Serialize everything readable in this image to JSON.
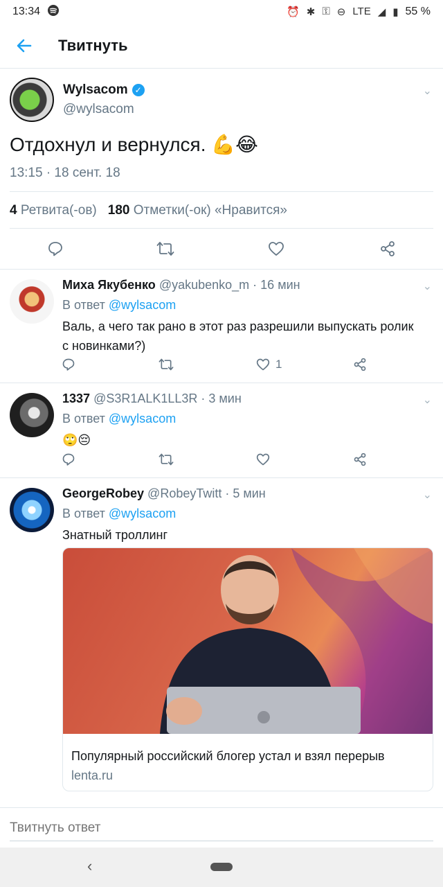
{
  "status_bar": {
    "time": "13:34",
    "network": "LTE",
    "battery": "55 %"
  },
  "header": {
    "title": "Твитнуть"
  },
  "main_tweet": {
    "name": "Wylsacom",
    "handle": "@wylsacom",
    "text": "Отдохнул и вернулся. 💪😂",
    "time": "13:15 · 18 сент. 18",
    "retweets_count": "4",
    "retweets_label": "Ретвита(-ов)",
    "likes_count": "180",
    "likes_label": "Отметки(-ок) «Нравится»"
  },
  "replies": [
    {
      "name": "Миха Якубенко",
      "meta": "@yakubenko_m · 16 мин",
      "reply_prefix": "В ответ",
      "reply_to": "@wylsacom",
      "text": "Валь, а чего так рано в этот раз разрешили выпускать ролик с новинками?)",
      "likes": "1"
    },
    {
      "name": "1337",
      "meta": "@S3R1ALK1LL3R · 3 мин",
      "reply_prefix": "В ответ",
      "reply_to": "@wylsacom",
      "text": "🙄😔",
      "likes": ""
    },
    {
      "name": "GeorgeRobey",
      "meta": "@RobeyTwitt · 5 мин",
      "reply_prefix": "В ответ",
      "reply_to": "@wylsacom",
      "text": "Знатный троллинг",
      "likes": "",
      "card": {
        "title": "Популярный российский блогер устал и взял перерыв",
        "domain": "lenta.ru"
      }
    }
  ],
  "compose": {
    "placeholder": "Твитнуть ответ"
  },
  "colors": {
    "accent": "#1da1f2",
    "secondary_text": "#657786",
    "border": "#e1e8ed"
  }
}
